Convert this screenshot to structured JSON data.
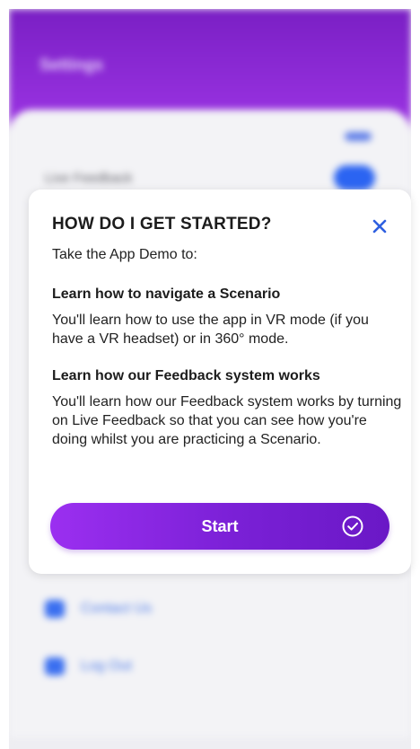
{
  "background": {
    "header_title": "Settings",
    "live_feedback_label": "Live Feedback",
    "links": [
      {
        "label": "Contact Us",
        "icon": "mail-icon"
      },
      {
        "label": "Log Out",
        "icon": "logout-icon"
      }
    ],
    "tabs": [
      {
        "icon": "trophy-icon"
      },
      {
        "icon": "headset-icon"
      },
      {
        "icon": "settings-icon"
      }
    ]
  },
  "modal": {
    "title": "HOW DO I GET STARTED?",
    "close_icon": "close-icon",
    "intro": "Take the App Demo to:",
    "sections": [
      {
        "heading": "Learn how to navigate a Scenario",
        "text": "You'll learn how to use the app in VR mode (if you have a VR headset) or in 360° mode."
      },
      {
        "heading": "Learn how our Feedback system works",
        "text": "You'll learn how our Feedback system works by turning on Live Feedback so that you can see how you're doing whilst you are practicing a Scenario."
      }
    ],
    "start_label": "Start",
    "start_icon": "check-circle-icon"
  },
  "colors": {
    "accent_purple": "#7a20d6",
    "close_blue": "#2e5fe0"
  }
}
